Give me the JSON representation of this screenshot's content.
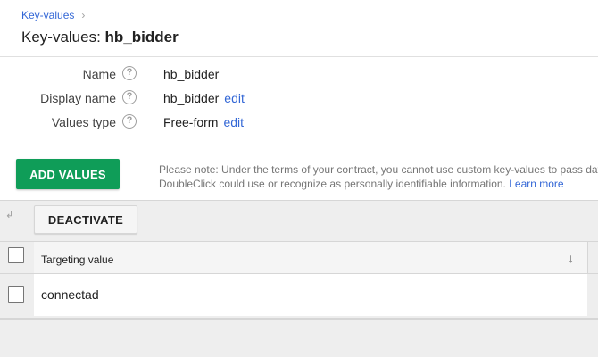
{
  "breadcrumb": {
    "label": "Key-values",
    "separator": "›"
  },
  "title": {
    "prefix": "Key-values: ",
    "name": "hb_bidder"
  },
  "details": [
    {
      "label": "Name",
      "value": "hb_bidder",
      "edit": ""
    },
    {
      "label": "Display name",
      "value": "hb_bidder",
      "edit": "edit"
    },
    {
      "label": "Values type",
      "value": "Free-form",
      "edit": "edit"
    }
  ],
  "help_icon_glyph": "?",
  "add_values_label": "ADD VALUES",
  "note": {
    "line1": "Please note: Under the terms of your contract, you cannot use custom key-values to pass data",
    "line2": "DoubleClick could use or recognize as personally identifiable information.",
    "learn_more": "Learn more"
  },
  "toolbar": {
    "collapse_glyph": "↲",
    "deactivate_label": "DEACTIVATE"
  },
  "table": {
    "column_header": "Targeting value",
    "sort_glyph": "↓",
    "rows": [
      {
        "value": "connectad"
      }
    ]
  },
  "colors": {
    "link": "#3367d6",
    "primary_button": "#0f9d58",
    "table_background": "#eeeeee"
  }
}
